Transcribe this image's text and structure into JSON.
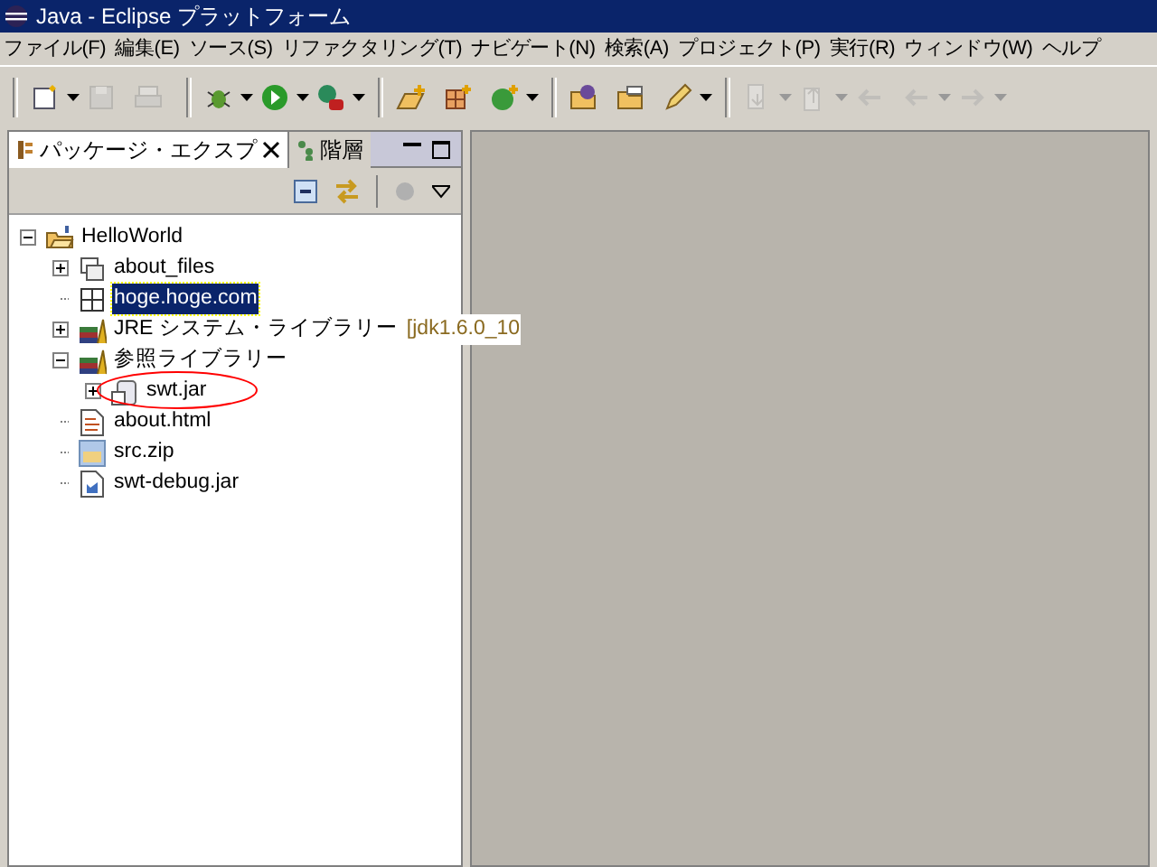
{
  "window": {
    "title": "Java - Eclipse プラットフォーム"
  },
  "menu": [
    "ファイル(F)",
    "編集(E)",
    "ソース(S)",
    "リファクタリング(T)",
    "ナビゲート(N)",
    "検索(A)",
    "プロジェクト(P)",
    "実行(R)",
    "ウィンドウ(W)",
    "ヘルプ"
  ],
  "toolbar": [
    {
      "kind": "sep"
    },
    {
      "kind": "new",
      "disabled": false,
      "dropdown": true
    },
    {
      "kind": "save",
      "disabled": true,
      "dropdown": false
    },
    {
      "kind": "print",
      "disabled": true,
      "dropdown": false
    },
    {
      "kind": "sep"
    },
    {
      "kind": "debug",
      "disabled": false,
      "dropdown": true
    },
    {
      "kind": "run",
      "disabled": false,
      "dropdown": true
    },
    {
      "kind": "external",
      "disabled": false,
      "dropdown": true
    },
    {
      "kind": "sep"
    },
    {
      "kind": "newpackage",
      "disabled": false,
      "dropdown": false
    },
    {
      "kind": "newclass",
      "disabled": false,
      "dropdown": false
    },
    {
      "kind": "newc",
      "disabled": false,
      "dropdown": true
    },
    {
      "kind": "sep"
    },
    {
      "kind": "opentype",
      "disabled": false,
      "dropdown": false
    },
    {
      "kind": "openfolder",
      "disabled": false,
      "dropdown": false
    },
    {
      "kind": "pen",
      "disabled": false,
      "dropdown": true
    },
    {
      "kind": "sep"
    },
    {
      "kind": "down",
      "disabled": true,
      "dropdown": true
    },
    {
      "kind": "up",
      "disabled": true,
      "dropdown": true
    },
    {
      "kind": "last",
      "disabled": true,
      "dropdown": false
    },
    {
      "kind": "back",
      "disabled": true,
      "dropdown": true
    },
    {
      "kind": "forward",
      "disabled": true,
      "dropdown": true
    }
  ],
  "view_tabs": [
    {
      "label": "パッケージ・エクスプ",
      "selected": true
    },
    {
      "label": "階層",
      "selected": false
    }
  ],
  "tree": [
    {
      "label": "HelloWorld",
      "kind": "project",
      "expandable": true,
      "expanded": true,
      "selected": false,
      "children": [
        {
          "label": "about_files",
          "kind": "folder",
          "expandable": true,
          "expanded": false,
          "selected": false
        },
        {
          "label": "hoge.hoge.com",
          "kind": "package",
          "expandable": false,
          "selected": true
        },
        {
          "label": "JRE システム・ライブラリー",
          "suffix": "[jdk1.6.0_10",
          "kind": "library",
          "expandable": true,
          "expanded": false,
          "selected": false
        },
        {
          "label": "参照ライブラリー",
          "kind": "library",
          "expandable": true,
          "expanded": true,
          "selected": false,
          "children": [
            {
              "label": "swt.jar",
              "kind": "jar",
              "expandable": true,
              "expanded": false,
              "selected": false,
              "circled": true
            }
          ]
        },
        {
          "label": "about.html",
          "kind": "file",
          "expandable": false,
          "selected": false
        },
        {
          "label": "src.zip",
          "kind": "zip",
          "expandable": false,
          "selected": false
        },
        {
          "label": "swt-debug.jar",
          "kind": "jarfile",
          "expandable": false,
          "selected": false
        }
      ]
    }
  ]
}
